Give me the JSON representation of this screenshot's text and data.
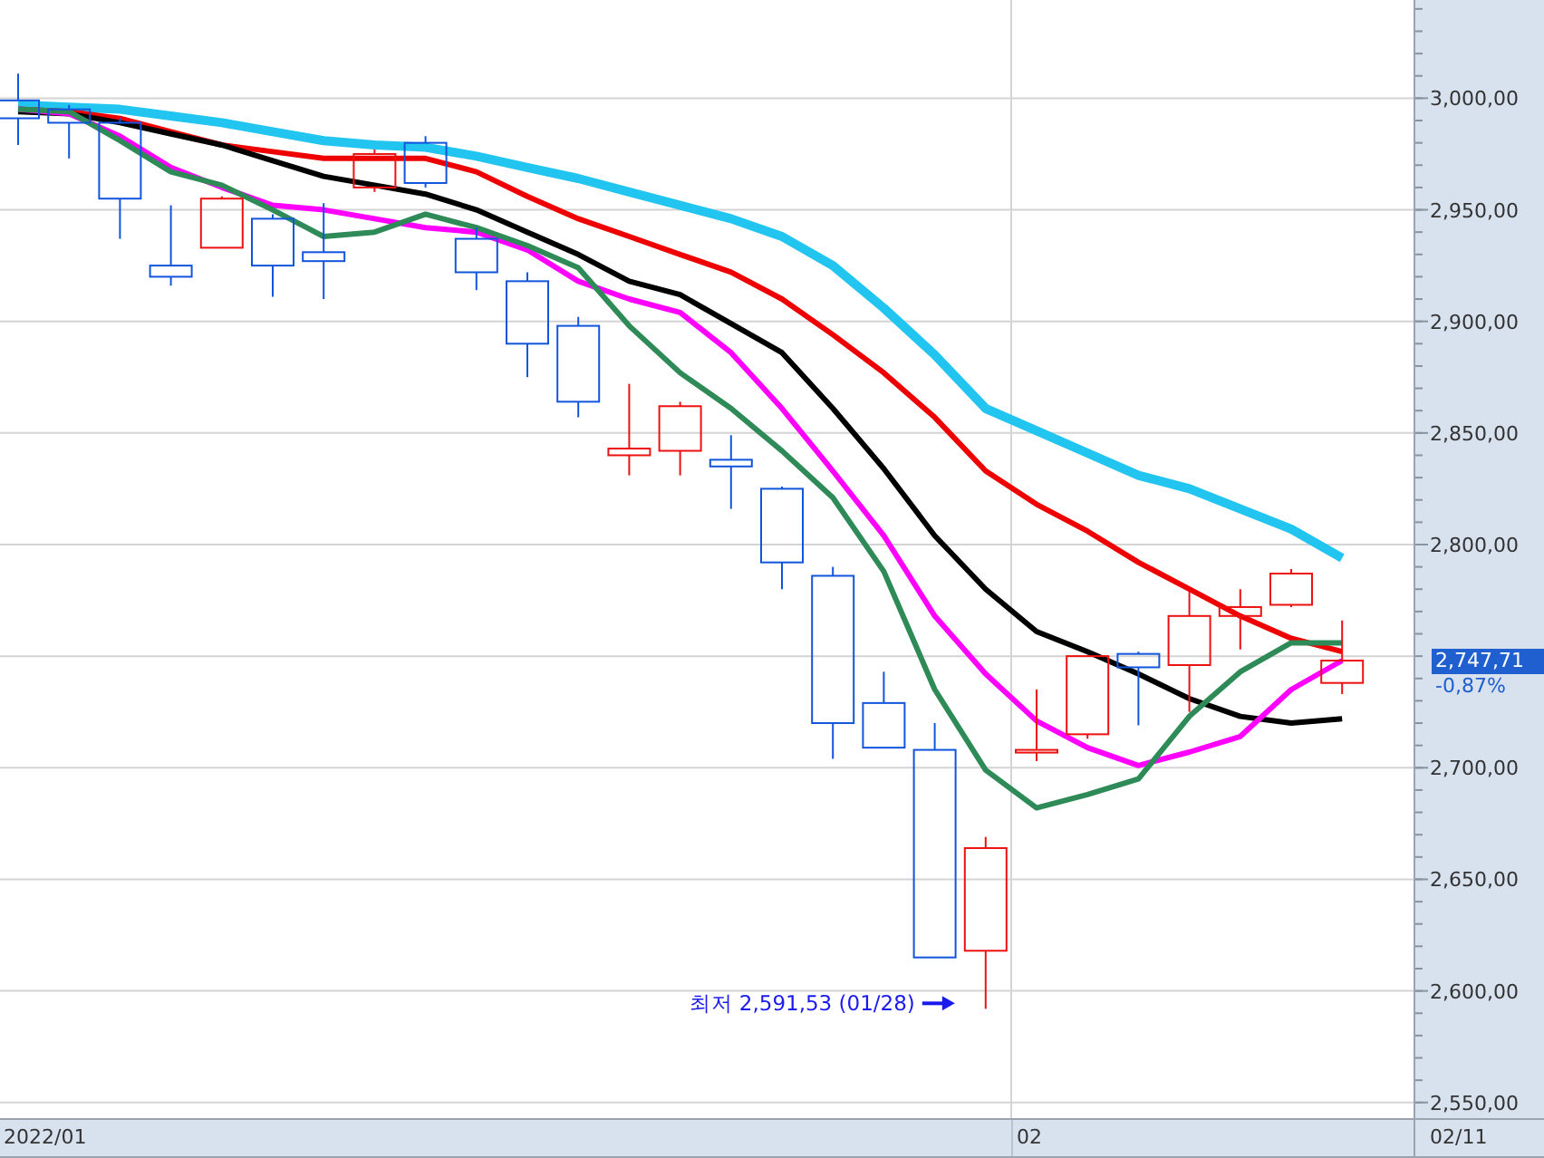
{
  "chart": {
    "y_axis_labels": [
      "3,000,00",
      "2,950,00",
      "2,900,00",
      "2,850,00",
      "2,800,00",
      "2,700,00",
      "2,650,00",
      "2,600,00",
      "2,550,00"
    ],
    "x_axis_labels": [
      "2022/01",
      "02"
    ],
    "low_note": "최저 2,591,53 (01/28)"
  },
  "price_tag": {
    "value": "2,747,71",
    "change": "-0,87%"
  },
  "last_date": "02/11"
}
